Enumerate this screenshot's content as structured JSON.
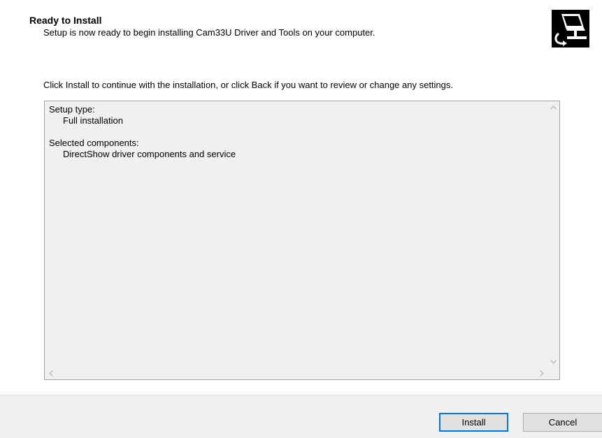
{
  "header": {
    "title": "Ready to Install",
    "subtitle": "Setup is now ready to begin installing Cam33U Driver and Tools on your computer.",
    "icon": "setup-computer-icon"
  },
  "instruction": "Click Install to continue with the installation, or click Back if you want to review or change any settings.",
  "memo": {
    "setup_type_label": "Setup type:",
    "setup_type_value": "Full installation",
    "components_label": "Selected components:",
    "components_value": "DirectShow driver components and service"
  },
  "buttons": {
    "install": "Install",
    "cancel": "Cancel"
  },
  "colors": {
    "memo_background": "#f0f0f0",
    "footer_background": "#f0f0f0",
    "default_button_border": "#0078d7"
  }
}
